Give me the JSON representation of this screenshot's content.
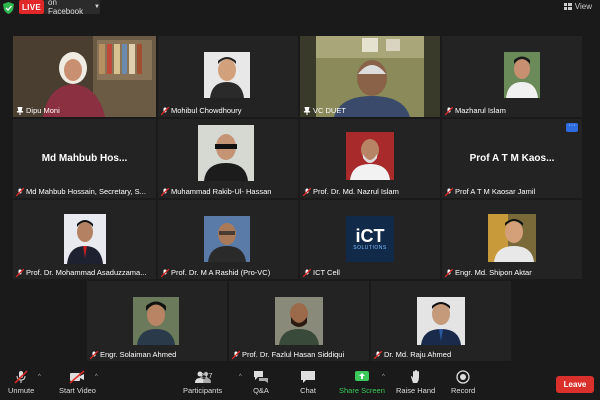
{
  "topbar": {
    "live_label": "LIVE",
    "stream_label": "on Facebook",
    "view_label": "View"
  },
  "participants": [
    {
      "name": "Dipu Moni",
      "pinned": true,
      "active": true
    },
    {
      "name": "Mohibul Chowdhoury",
      "muted": true
    },
    {
      "name": "VC DUET",
      "pinned": true
    },
    {
      "name": "Mazharul Islam",
      "muted": true
    },
    {
      "name": "Md Mahbub Hossain, Secretary, S...",
      "muted": true,
      "display": "Md Mahbub Hos..."
    },
    {
      "name": "Muhammad Rakib-Ul- Hassan",
      "muted": true
    },
    {
      "name": "Prof. Dr. Md. Nazrul Islam",
      "muted": true
    },
    {
      "name": "Prof A T M Kaosar Jamil",
      "muted": true,
      "display": "Prof A T M Kaos..."
    },
    {
      "name": "Prof. Dr. Mohammad Asaduzzama...",
      "muted": true
    },
    {
      "name": "Prof. Dr. M A Rashid (Pro-VC)",
      "muted": true
    },
    {
      "name": "ICT Cell",
      "muted": true,
      "logo_text": "iCT",
      "logo_sub": "SOLUTIONS"
    },
    {
      "name": "Engr. Md.  Shipon Aktar",
      "muted": true
    },
    {
      "name": "Engr. Solaiman Ahmed",
      "muted": true
    },
    {
      "name": "Prof. Dr. Fazlul Hasan Siddiqui",
      "muted": true
    },
    {
      "name": "Dr. Md. Raju Ahmed",
      "muted": true
    }
  ],
  "toolbar": {
    "unmute": "Unmute",
    "start_video": "Start Video",
    "participants": "Participants",
    "participant_count": "217",
    "qa": "Q&A",
    "chat": "Chat",
    "share_screen": "Share Screen",
    "raise_hand": "Raise Hand",
    "record": "Record",
    "leave": "Leave"
  },
  "colors": {
    "active_border": "#d4d94a",
    "live": "#e02828",
    "share": "#3cc85a",
    "leave": "#d9302b"
  }
}
